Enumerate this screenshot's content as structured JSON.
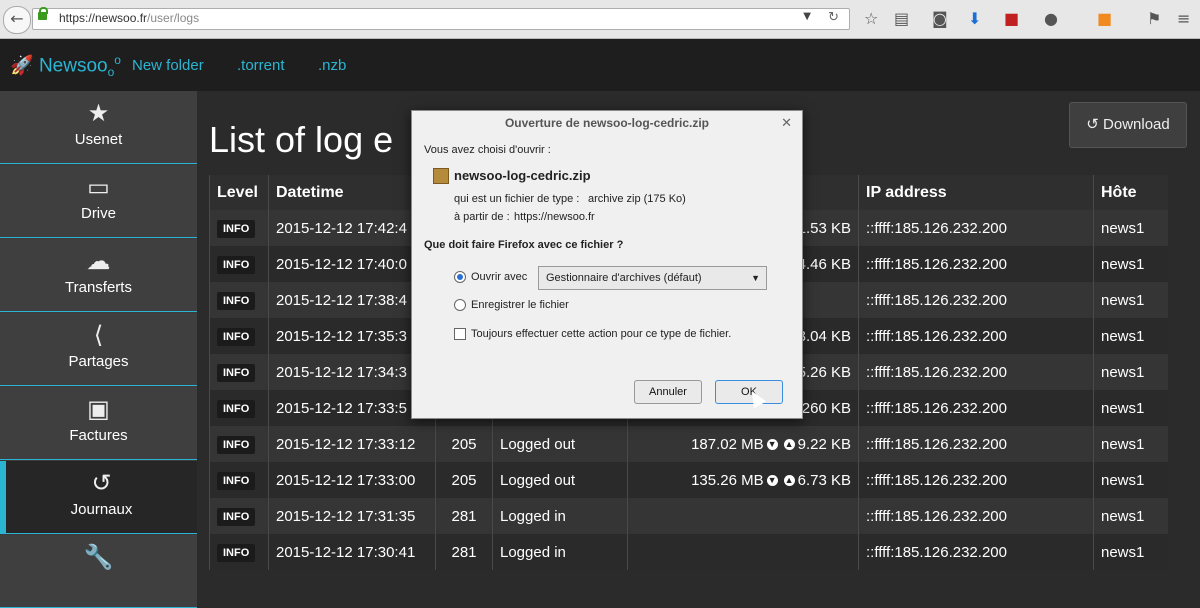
{
  "browser": {
    "url_host": "https://newsoo.fr",
    "url_path": "/user/logs",
    "back_icon": "arrow-left-icon"
  },
  "navbar": {
    "brand": "Newsoo",
    "links": [
      "New folder",
      ".torrent",
      ".nzb"
    ]
  },
  "sidebar": {
    "items": [
      {
        "label": "Usenet",
        "icon": "star-icon"
      },
      {
        "label": "Drive",
        "icon": "hard-drive-icon"
      },
      {
        "label": "Transferts",
        "icon": "cloud-download-icon"
      },
      {
        "label": "Partages",
        "icon": "share-icon"
      },
      {
        "label": "Factures",
        "icon": "banknote-icon"
      },
      {
        "label": "Journaux",
        "icon": "history-icon"
      },
      {
        "label": "",
        "icon": "wrench-icon"
      }
    ]
  },
  "main": {
    "title": "List of log e",
    "download_label": "Download"
  },
  "table": {
    "headers": [
      "Level",
      "Datetime",
      "",
      "",
      "",
      "IP address",
      "Hôte"
    ],
    "rows": [
      {
        "level": "INFO",
        "datetime": "2015-12-12 17:42:4",
        "code": "",
        "action": "",
        "down": "",
        "up": "91.53 KB",
        "ip": "::ffff:185.126.232.200",
        "host": "news1"
      },
      {
        "level": "INFO",
        "datetime": "2015-12-12 17:40:0",
        "code": "",
        "action": "",
        "down": "",
        "up": "344.46 KB",
        "ip": "::ffff:185.126.232.200",
        "host": "news1"
      },
      {
        "level": "INFO",
        "datetime": "2015-12-12 17:38:4",
        "code": "",
        "action": "",
        "down": "",
        "up": "",
        "ip": "::ffff:185.126.232.200",
        "host": "news1"
      },
      {
        "level": "INFO",
        "datetime": "2015-12-12 17:35:3",
        "code": "",
        "action": "",
        "down": "",
        "up": "13.04 KB",
        "ip": "::ffff:185.126.232.200",
        "host": "news1"
      },
      {
        "level": "INFO",
        "datetime": "2015-12-12 17:34:3",
        "code": "",
        "action": "",
        "down": "",
        "up": "5.26 KB",
        "ip": "::ffff:185.126.232.200",
        "host": "news1"
      },
      {
        "level": "INFO",
        "datetime": "2015-12-12 17:33:5",
        "code": "",
        "action": "",
        "down": "",
        "up": "260 KB",
        "ip": "::ffff:185.126.232.200",
        "host": "news1"
      },
      {
        "level": "INFO",
        "datetime": "2015-12-12 17:33:12",
        "code": "205",
        "action": "Logged out",
        "down": "187.02 MB",
        "up": "9.22 KB",
        "ip": "::ffff:185.126.232.200",
        "host": "news1"
      },
      {
        "level": "INFO",
        "datetime": "2015-12-12 17:33:00",
        "code": "205",
        "action": "Logged out",
        "down": "135.26 MB",
        "up": "6.73 KB",
        "ip": "::ffff:185.126.232.200",
        "host": "news1"
      },
      {
        "level": "INFO",
        "datetime": "2015-12-12 17:31:35",
        "code": "281",
        "action": "Logged in",
        "down": "",
        "up": "",
        "ip": "::ffff:185.126.232.200",
        "host": "news1"
      },
      {
        "level": "INFO",
        "datetime": "2015-12-12 17:30:41",
        "code": "281",
        "action": "Logged in",
        "down": "",
        "up": "",
        "ip": "::ffff:185.126.232.200",
        "host": "news1"
      }
    ]
  },
  "dialog": {
    "title": "Ouverture de newsoo-log-cedric.zip",
    "intro": "Vous avez choisi d'ouvrir :",
    "filename": "newsoo-log-cedric.zip",
    "type_label": "qui est un fichier de type :",
    "type_value": "archive zip (175 Ko)",
    "from_label": "à partir de :",
    "from_value": "https://newsoo.fr",
    "question": "Que doit faire Firefox avec ce fichier ?",
    "open_with_label": "Ouvrir avec",
    "open_with_value": "Gestionnaire d'archives (défaut)",
    "save_label": "Enregistrer le fichier",
    "always_label": "Toujours effectuer cette action pour ce type de fichier.",
    "cancel_label": "Annuler",
    "ok_label": "OK"
  }
}
